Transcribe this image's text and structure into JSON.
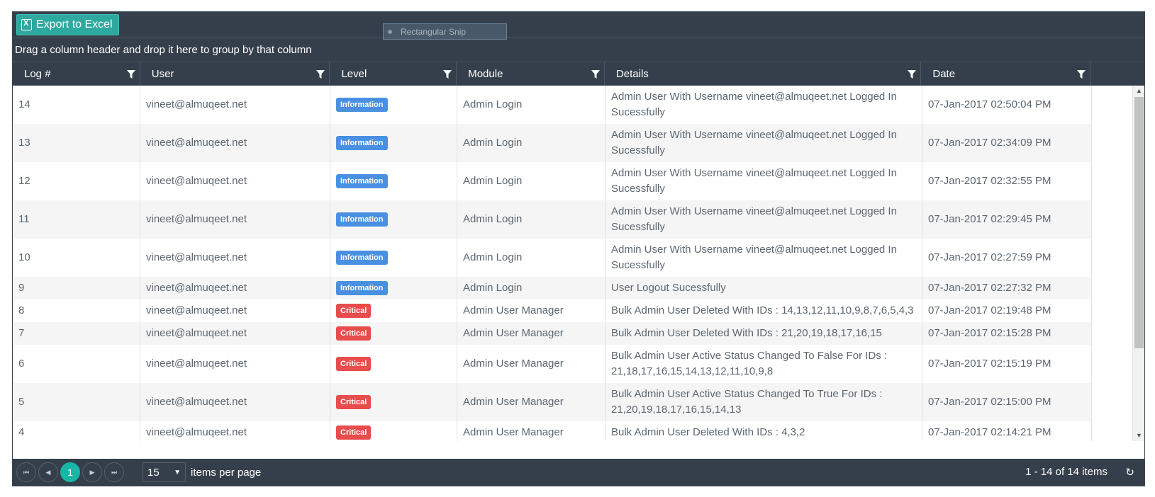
{
  "toolbar": {
    "export_label": "Export to Excel"
  },
  "snip": {
    "label": "Rectangular Snip"
  },
  "group_panel": {
    "text": "Drag a column header and drop it here to group by that column"
  },
  "columns": [
    "Log #",
    "User",
    "Level",
    "Module",
    "Details",
    "Date"
  ],
  "rows": [
    {
      "log": "14",
      "user": "vineet@almuqeet.net",
      "level": "Information",
      "module": "Admin Login",
      "details": "Admin User With Username vineet@almuqeet.net Logged In Sucessfully",
      "date": "07-Jan-2017 02:50:04 PM"
    },
    {
      "log": "13",
      "user": "vineet@almuqeet.net",
      "level": "Information",
      "module": "Admin Login",
      "details": "Admin User With Username vineet@almuqeet.net Logged In Sucessfully",
      "date": "07-Jan-2017 02:34:09 PM"
    },
    {
      "log": "12",
      "user": "vineet@almuqeet.net",
      "level": "Information",
      "module": "Admin Login",
      "details": "Admin User With Username vineet@almuqeet.net Logged In Sucessfully",
      "date": "07-Jan-2017 02:32:55 PM"
    },
    {
      "log": "11",
      "user": "vineet@almuqeet.net",
      "level": "Information",
      "module": "Admin Login",
      "details": "Admin User With Username vineet@almuqeet.net Logged In Sucessfully",
      "date": "07-Jan-2017 02:29:45 PM"
    },
    {
      "log": "10",
      "user": "vineet@almuqeet.net",
      "level": "Information",
      "module": "Admin Login",
      "details": "Admin User With Username vineet@almuqeet.net Logged In Sucessfully",
      "date": "07-Jan-2017 02:27:59 PM"
    },
    {
      "log": "9",
      "user": "vineet@almuqeet.net",
      "level": "Information",
      "module": "Admin Login",
      "details": "User Logout Sucessfully",
      "date": "07-Jan-2017 02:27:32 PM"
    },
    {
      "log": "8",
      "user": "vineet@almuqeet.net",
      "level": "Critical",
      "module": "Admin User Manager",
      "details": "Bulk Admin User Deleted With IDs : 14,13,12,11,10,9,8,7,6,5,4,3",
      "date": "07-Jan-2017 02:19:48 PM"
    },
    {
      "log": "7",
      "user": "vineet@almuqeet.net",
      "level": "Critical",
      "module": "Admin User Manager",
      "details": "Bulk Admin User Deleted With IDs : 21,20,19,18,17,16,15",
      "date": "07-Jan-2017 02:15:28 PM"
    },
    {
      "log": "6",
      "user": "vineet@almuqeet.net",
      "level": "Critical",
      "module": "Admin User Manager",
      "details": "Bulk Admin User Active Status Changed To False For IDs : 21,18,17,16,15,14,13,12,11,10,9,8",
      "date": "07-Jan-2017 02:15:19 PM"
    },
    {
      "log": "5",
      "user": "vineet@almuqeet.net",
      "level": "Critical",
      "module": "Admin User Manager",
      "details": "Bulk Admin User Active Status Changed To True For IDs : 21,20,19,18,17,16,15,14,13",
      "date": "07-Jan-2017 02:15:00 PM"
    },
    {
      "log": "4",
      "user": "vineet@almuqeet.net",
      "level": "Critical",
      "module": "Admin User Manager",
      "details": "Bulk Admin User Deleted With IDs : 4,3,2",
      "date": "07-Jan-2017 02:14:21 PM"
    }
  ],
  "pager": {
    "current_page": "1",
    "page_size": "15",
    "items_per_page_label": "items per page",
    "range_text": "1 - 14 of 14 items"
  },
  "colors": {
    "header_bg": "#353f4b",
    "export_btn": "#2ea9a0",
    "info_badge": "#4a90e2",
    "critical_badge": "#e84c4c",
    "current_page": "#19b5a6"
  },
  "icons": {
    "export": "excel-icon",
    "filter": "filter-icon",
    "first": "first-page-icon",
    "prev": "prev-page-icon",
    "next": "next-page-icon",
    "last": "last-page-icon",
    "refresh": "refresh-icon"
  }
}
